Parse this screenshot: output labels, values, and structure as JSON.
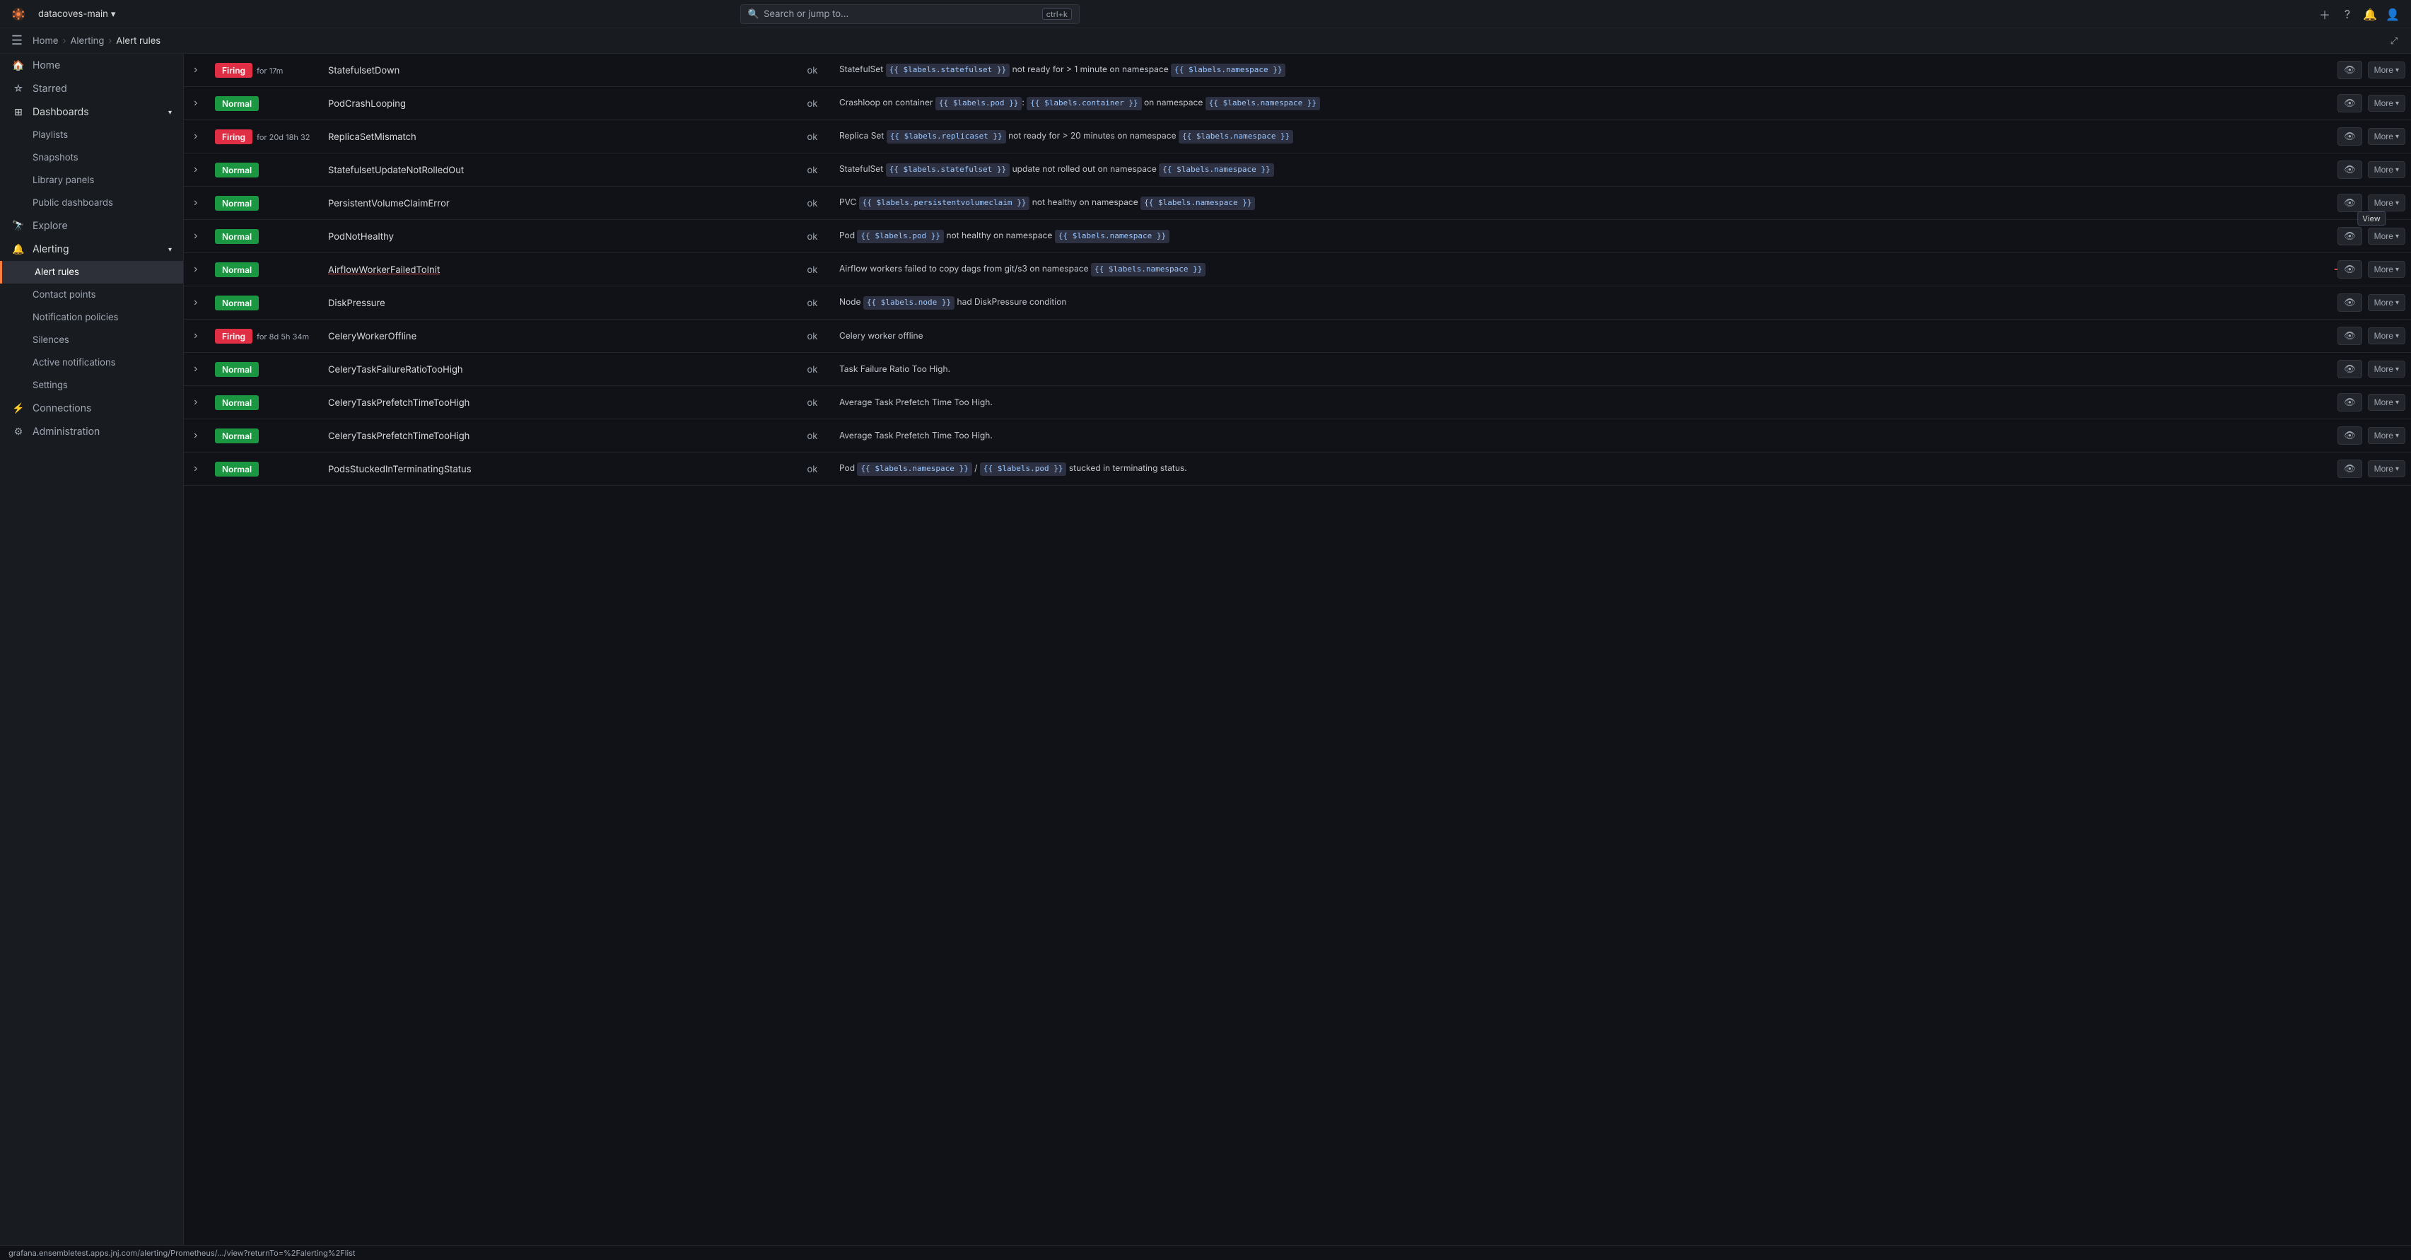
{
  "topbar": {
    "workspace": "datacoves-main",
    "search_placeholder": "Search or jump to...",
    "kbd": "ctrl+k",
    "plus_label": "+",
    "help_icon": "?",
    "bell_icon": "🔔",
    "user_icon": "👤"
  },
  "breadcrumb": {
    "home": "Home",
    "alerting": "Alerting",
    "current": "Alert rules"
  },
  "sidebar": {
    "hamburger": "☰",
    "items": [
      {
        "id": "home",
        "icon": "🏠",
        "label": "Home"
      },
      {
        "id": "starred",
        "icon": "☆",
        "label": "Starred"
      },
      {
        "id": "dashboards",
        "icon": "⊞",
        "label": "Dashboards",
        "expanded": true
      },
      {
        "id": "playlists",
        "icon": "",
        "label": "Playlists",
        "indent": true
      },
      {
        "id": "snapshots",
        "icon": "",
        "label": "Snapshots",
        "indent": true
      },
      {
        "id": "library-panels",
        "icon": "",
        "label": "Library panels",
        "indent": true
      },
      {
        "id": "public-dashboards",
        "icon": "",
        "label": "Public dashboards",
        "indent": true
      },
      {
        "id": "explore",
        "icon": "🔭",
        "label": "Explore"
      },
      {
        "id": "alerting",
        "icon": "🔔",
        "label": "Alerting",
        "expanded": true
      },
      {
        "id": "alert-rules",
        "icon": "",
        "label": "Alert rules",
        "indent": true,
        "active": true
      },
      {
        "id": "contact-points",
        "icon": "",
        "label": "Contact points",
        "indent": true
      },
      {
        "id": "notification-policies",
        "icon": "",
        "label": "Notification policies",
        "indent": true
      },
      {
        "id": "silences",
        "icon": "",
        "label": "Silences",
        "indent": true
      },
      {
        "id": "active-notifications",
        "icon": "",
        "label": "Active notifications",
        "indent": true
      },
      {
        "id": "settings-alert",
        "icon": "",
        "label": "Settings",
        "indent": true
      },
      {
        "id": "connections",
        "icon": "⚡",
        "label": "Connections"
      },
      {
        "id": "administration",
        "icon": "⚙",
        "label": "Administration"
      }
    ]
  },
  "alert_rules": {
    "rows": [
      {
        "status": "Firing",
        "status_type": "firing",
        "duration": "for 17m",
        "name": "StatefulsetDown",
        "state": "ok",
        "summary_parts": [
          {
            "type": "text",
            "value": "StatefulSet "
          },
          {
            "type": "tag",
            "value": "{{ $labels.statefulset }}"
          },
          {
            "type": "text",
            "value": " not ready for > 1 minute on namespace "
          },
          {
            "type": "tag",
            "value": "{{ $labels.namespace }}"
          }
        ],
        "summary_raw": "StatefulSet {{ $labels.statefulset }} not ready for > 1 minute on namespace {{ $labels.namespace }}"
      },
      {
        "status": "Normal",
        "status_type": "normal",
        "duration": "",
        "name": "PodCrashLooping",
        "state": "ok",
        "summary_raw": "Crashloop on container {{ $labels.pod }}: {{ $labels.container }} on namespace {{ $labels.namespace }}"
      },
      {
        "status": "Firing",
        "status_type": "firing",
        "duration": "for 20d 18h 32",
        "name": "ReplicaSetMismatch",
        "state": "ok",
        "summary_raw": "Replica Set {{ $labels.replicaset }} not ready for > 20 minutes on namespace {{ $labels.namespace }}"
      },
      {
        "status": "Normal",
        "status_type": "normal",
        "duration": "",
        "name": "StatefulsetUpdateNotRolledOut",
        "state": "ok",
        "summary_raw": "StatefulSet {{ $labels.statefulset }} update not rolled out on namespace {{ $labels.namespace }}"
      },
      {
        "status": "Normal",
        "status_type": "normal",
        "duration": "",
        "name": "PersistentVolumeClaimError",
        "state": "ok",
        "summary_raw": "PVC {{ $labels.persistentvolumeclaim }} not healthy on namespace {{ $labels.namespace }}"
      },
      {
        "status": "Normal",
        "status_type": "normal",
        "duration": "",
        "name": "PodNotHealthy",
        "state": "ok",
        "summary_raw": "Pod {{ $labels.pod }} not healthy on namespace {{ $labels.namespace }}"
      },
      {
        "status": "Normal",
        "status_type": "normal",
        "duration": "",
        "name": "AirflowWorkerFailedToInit",
        "state": "ok",
        "summary_raw": "Airflow workers failed to copy dags from git/s3 on namespace {{ $labels.namespace }}",
        "underline": true,
        "has_arrow": true
      },
      {
        "status": "Normal",
        "status_type": "normal",
        "duration": "",
        "name": "DiskPressure",
        "state": "ok",
        "summary_raw": "Node {{ $labels.node }} had DiskPressure condition"
      },
      {
        "status": "Firing",
        "status_type": "firing",
        "duration": "for 8d 5h 34m",
        "name": "CeleryWorkerOffline",
        "state": "ok",
        "summary_raw": "Celery worker offline"
      },
      {
        "status": "Normal",
        "status_type": "normal",
        "duration": "",
        "name": "CeleryTaskFailureRatioTooHigh",
        "state": "ok",
        "summary_raw": "Task Failure Ratio Too High."
      },
      {
        "status": "Normal",
        "status_type": "normal",
        "duration": "",
        "name": "CeleryTaskPrefetchTimeTooHigh",
        "state": "ok",
        "summary_raw": "Average Task Prefetch Time Too High."
      },
      {
        "status": "Normal",
        "status_type": "normal",
        "duration": "",
        "name": "CeleryTaskPrefetchTimeTooHigh",
        "state": "ok",
        "summary_raw": "Average Task Prefetch Time Too High."
      },
      {
        "status": "Normal",
        "status_type": "normal",
        "duration": "",
        "name": "PodsStuckedInTerminatingStatus",
        "state": "ok",
        "summary_raw": "Pod {{ $labels.namespace }} / {{ $labels.pod }} stucked in terminating status."
      }
    ]
  },
  "status_bar": {
    "url": "grafana.ensembletest.apps.jnj.com/alerting/Prometheus/.../view?returnTo=%2Falerting%2Flist"
  },
  "labels": {
    "more": "More",
    "view_tooltip": "View"
  }
}
